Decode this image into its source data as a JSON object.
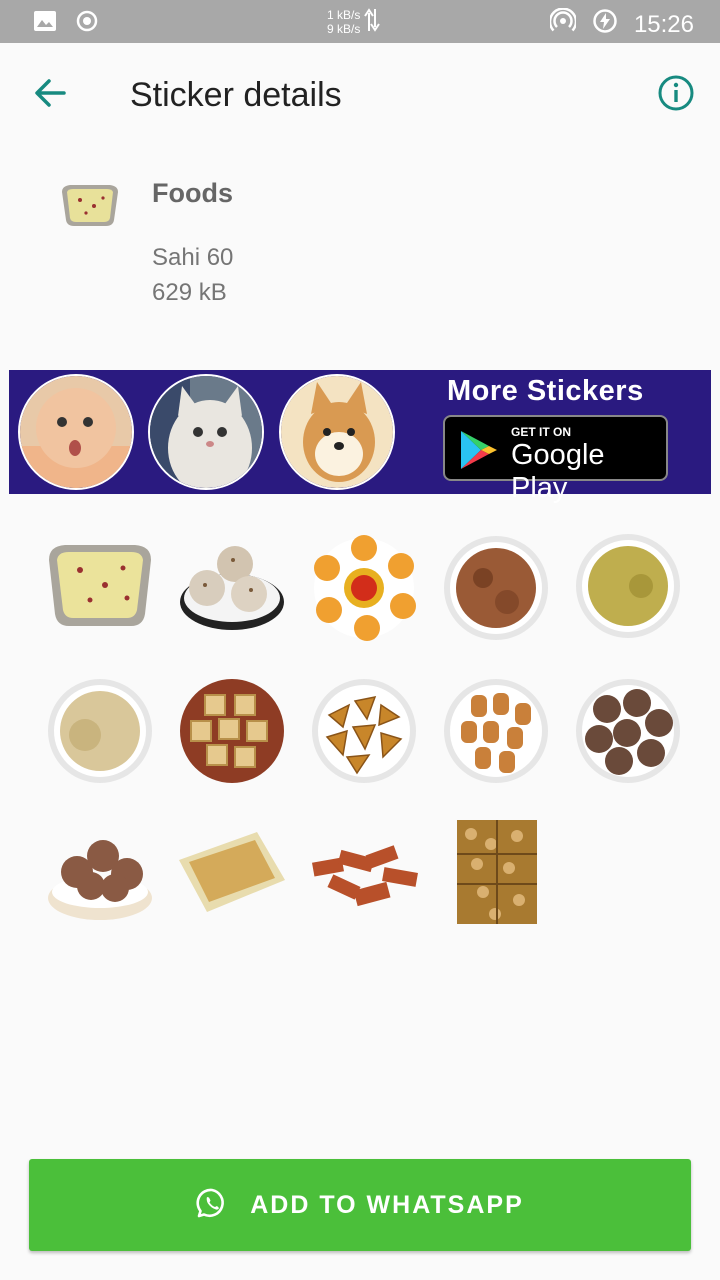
{
  "status_bar": {
    "net_up": "1 kB/s",
    "net_down": "9 kB/s",
    "time": "15:26",
    "icons": [
      "image-icon",
      "record-icon",
      "data-arrows-icon",
      "hotspot-icon",
      "battery-charging-icon"
    ]
  },
  "app_bar": {
    "title": "Sticker details",
    "back_icon": "arrow-left-icon",
    "info_icon": "info-icon",
    "accent_color": "#178a80"
  },
  "pack": {
    "name": "Foods",
    "publisher": "Sahi 60",
    "size": "629 kB"
  },
  "banner": {
    "headline": "More Stickers",
    "store_small": "GET IT ON",
    "store_big": "Google Play",
    "background": "#2a1a80"
  },
  "stickers": [
    {
      "name": "sticker-rice-pudding"
    },
    {
      "name": "sticker-coconut-laddoo"
    },
    {
      "name": "sticker-fried-snacks"
    },
    {
      "name": "sticker-brown-halwa"
    },
    {
      "name": "sticker-yellow-halwa"
    },
    {
      "name": "sticker-khoya-ball"
    },
    {
      "name": "sticker-barfi"
    },
    {
      "name": "sticker-samosa"
    },
    {
      "name": "sticker-sweet-pieces"
    },
    {
      "name": "sticker-dry-fruit-laddoo"
    },
    {
      "name": "sticker-puffed-rice-balls"
    },
    {
      "name": "sticker-sesame-bar"
    },
    {
      "name": "sticker-sweet-sticks"
    },
    {
      "name": "sticker-nut-chikki"
    }
  ],
  "add_button": {
    "label": "ADD TO WHATSAPP",
    "icon": "whatsapp-icon",
    "color": "#4bbf3a"
  }
}
